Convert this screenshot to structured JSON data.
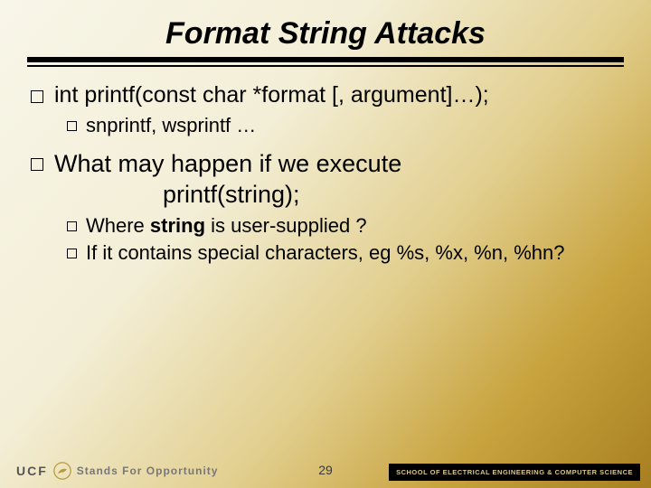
{
  "title": "Format String Attacks",
  "bullets": {
    "b1": "int printf(const char *format [, argument]…);",
    "b1a": "snprintf, wsprintf …",
    "b2_line1": "What may happen if we execute",
    "b2_line2": "printf(string);",
    "b2a_pre": "Where ",
    "b2a_bold": "string",
    "b2a_post": " is user-supplied ?",
    "b2b": "If it contains special characters, eg %s, %x, %n, %hn?"
  },
  "footer": {
    "ucf": "UCF",
    "tagline": "Stands For Opportunity",
    "page": "29",
    "school": "SCHOOL OF ELECTRICAL ENGINEERING & COMPUTER SCIENCE"
  }
}
